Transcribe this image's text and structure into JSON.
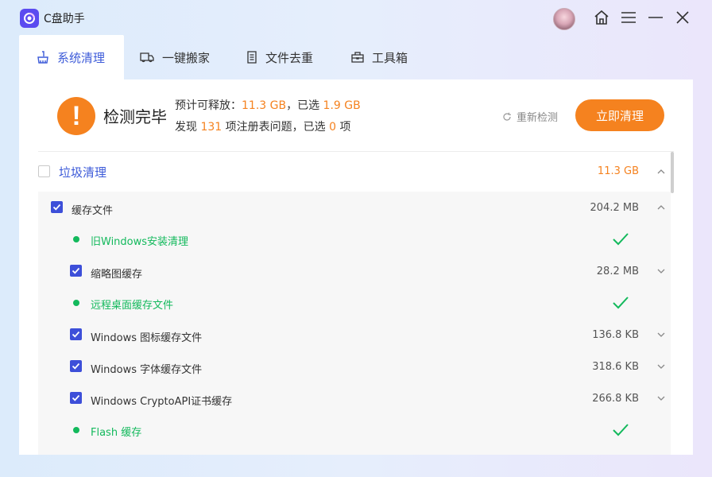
{
  "app": {
    "title": "C盘助手"
  },
  "tabs": [
    {
      "label": "系统清理",
      "icon": "broom-icon",
      "active": true
    },
    {
      "label": "一键搬家",
      "icon": "truck-icon",
      "active": false
    },
    {
      "label": "文件去重",
      "icon": "document-icon",
      "active": false
    },
    {
      "label": "工具箱",
      "icon": "toolbox-icon",
      "active": false
    }
  ],
  "scan": {
    "title": "检测完毕",
    "line1": {
      "prefix": "预计可释放：",
      "total": "11.3 GB",
      "mid": "，已选",
      "selected": "1.9 GB"
    },
    "line2": {
      "prefix": "发现",
      "count": "131",
      "mid": "项注册表问题，已选",
      "selected": "0",
      "suffix": "项"
    },
    "rescan_label": "重新检测",
    "clean_label": "立即清理"
  },
  "category": {
    "label": "垃圾清理",
    "size": "11.3 GB",
    "checked": false
  },
  "group": {
    "label": "缓存文件",
    "size": "204.2 MB",
    "checked": true
  },
  "items": [
    {
      "label": "旧Windows安装清理",
      "status": "done"
    },
    {
      "label": "缩略图缓存",
      "size": "28.2 MB",
      "status": "checked"
    },
    {
      "label": "远程桌面缓存文件",
      "status": "done"
    },
    {
      "label": "Windows 图标缓存文件",
      "size": "136.8 KB",
      "status": "checked"
    },
    {
      "label": "Windows 字体缓存文件",
      "size": "318.6 KB",
      "status": "checked"
    },
    {
      "label": "Windows CryptoAPI证书缓存",
      "size": "266.8 KB",
      "status": "checked"
    },
    {
      "label": "Flash 缓存",
      "status": "done"
    }
  ],
  "colors": {
    "accent": "#3d5bd9",
    "orange": "#f5821f",
    "green": "#13b95c",
    "checkbox": "#3d4fd9"
  }
}
